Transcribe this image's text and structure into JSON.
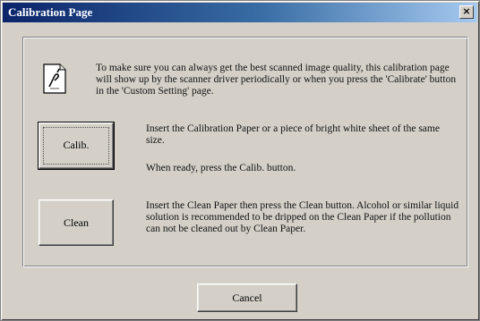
{
  "window": {
    "title": "Calibration Page",
    "close_glyph": "×"
  },
  "intro": {
    "icon": "document-icon",
    "text": "To make sure you can always get the best scanned image quality, this calibration page will show up by the scanner driver periodically or when you press the 'Calibrate' button in the 'Custom Setting' page."
  },
  "calibrate": {
    "button_label": "Calib.",
    "instruction": "Insert the Calibration Paper or a piece of bright white sheet of the same size.",
    "ready_text": "When ready, press the Calib. button."
  },
  "clean": {
    "button_label": "Clean",
    "instruction": "Insert the Clean Paper then press the Clean button. Alcohol or similar liquid solution is recommended to be dripped on the Clean Paper if the pollution can not be cleaned out by Clean Paper."
  },
  "footer": {
    "cancel_label": "Cancel"
  },
  "colors": {
    "title_start": "#0a246a",
    "title_end": "#a6caf0",
    "face": "#d4d0c8"
  }
}
